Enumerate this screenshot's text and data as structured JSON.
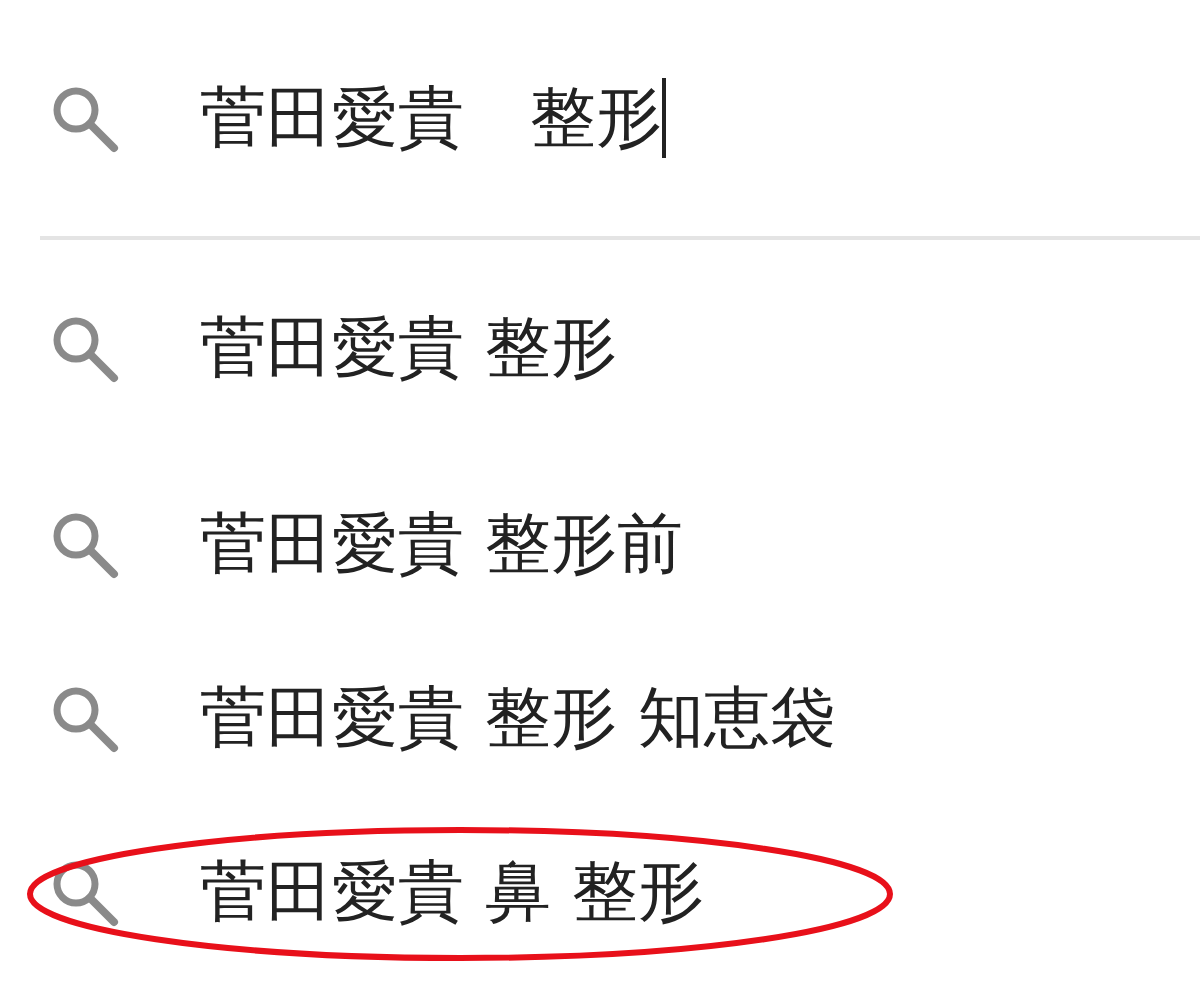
{
  "search": {
    "value": "菅田愛貴　整形",
    "focused": true
  },
  "suggestions": [
    {
      "text": "菅田愛貴 整形",
      "circled": false
    },
    {
      "text": "菅田愛貴 整形前",
      "circled": false
    },
    {
      "text": "菅田愛貴 整形 知恵袋",
      "circled": false
    },
    {
      "text": "菅田愛貴 鼻 整形",
      "circled": true
    }
  ]
}
